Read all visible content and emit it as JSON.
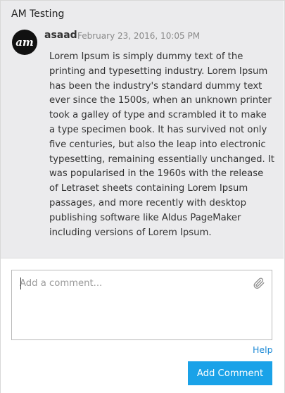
{
  "thread": {
    "title": "AM Testing"
  },
  "comment": {
    "avatar_icon": "am-logo-icon",
    "avatar_initials": "am",
    "author": "asaad",
    "timestamp": "February 23, 2016, 10:05 PM",
    "body": "Lorem Ipsum is simply dummy text of the printing and typesetting industry. Lorem Ipsum has been the industry's standard dummy text ever since the 1500s, when an unknown printer took a galley of type and scrambled it to make a type specimen book. It has survived not only five centuries, but also the leap into electronic typesetting, remaining essentially unchanged. It was popularised in the 1960s with the release of Letraset sheets containing Lorem Ipsum passages, and more recently with desktop publishing software like Aldus PageMaker including versions of Lorem Ipsum."
  },
  "composer": {
    "placeholder": "Add a comment...",
    "value": "",
    "attach_icon": "paperclip-icon",
    "help_label": "Help",
    "submit_label": "Add Comment"
  },
  "colors": {
    "thread_background": "#ebebed",
    "accent": "#1aa2e8",
    "link": "#1d8ad6"
  }
}
